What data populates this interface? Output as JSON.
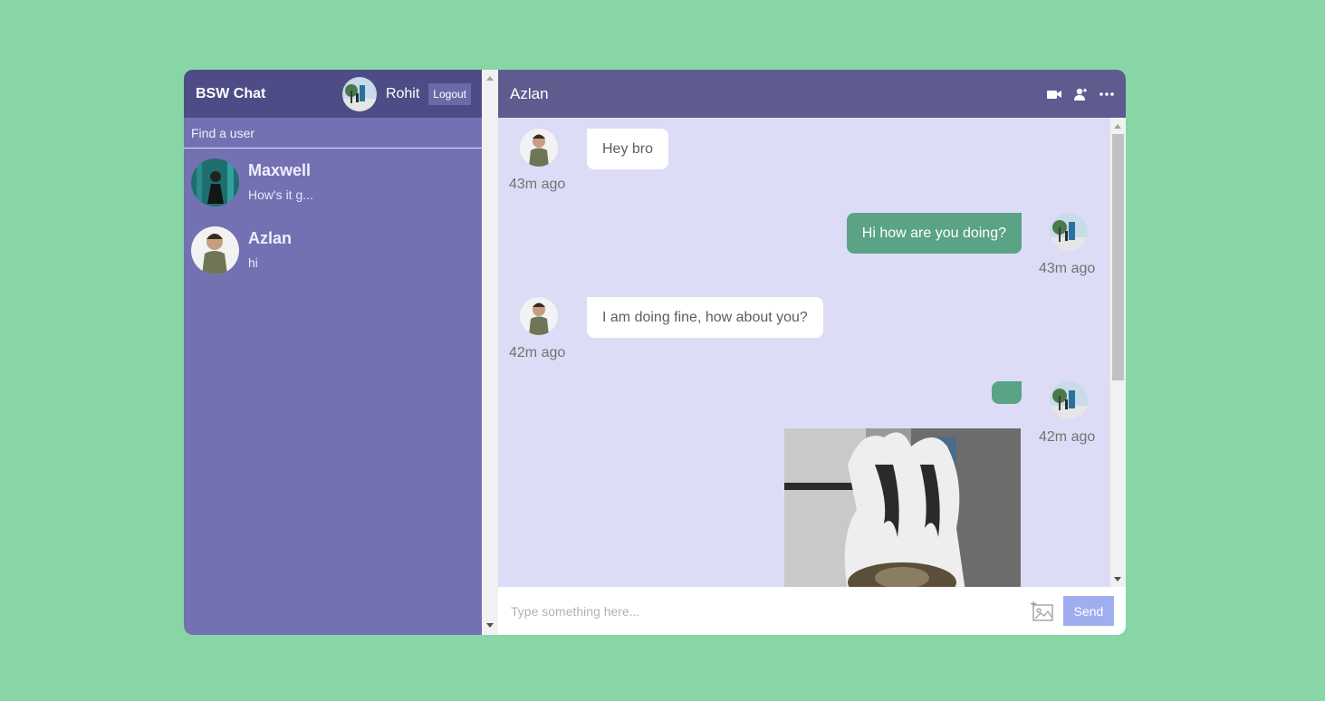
{
  "sidebar": {
    "brand": "BSW Chat",
    "current_user": {
      "name": "Rohit",
      "avatar": "rohit-avatar"
    },
    "logout_label": "Logout",
    "search_placeholder": "Find a user",
    "users": [
      {
        "name": "Maxwell",
        "last_message": "How's it g..."
      },
      {
        "name": "Azlan",
        "last_message": "hi"
      }
    ]
  },
  "chat": {
    "title": "Azlan",
    "header_icons": [
      "video-camera-icon",
      "add-user-icon",
      "more-icon"
    ],
    "messages": [
      {
        "direction": "in",
        "text": "Hey bro",
        "time": "43m ago"
      },
      {
        "direction": "out",
        "text": "Hi how are you doing?",
        "time": "43m ago"
      },
      {
        "direction": "in",
        "text": "I am doing fine, how about you?",
        "time": "42m ago"
      },
      {
        "direction": "out",
        "text": "",
        "time": "42m ago",
        "has_image": true
      }
    ],
    "input_placeholder": "Type something here...",
    "send_label": "Send"
  },
  "colors": {
    "page_bg": "#88d6a6",
    "sidebar_bg": "#7371b2",
    "sidebar_header_bg": "#4e4c86",
    "chat_header_bg": "#5e5b8f",
    "messages_bg": "#dddcf6",
    "outgoing_bubble": "#5aa385",
    "send_button": "#a0aef0"
  }
}
